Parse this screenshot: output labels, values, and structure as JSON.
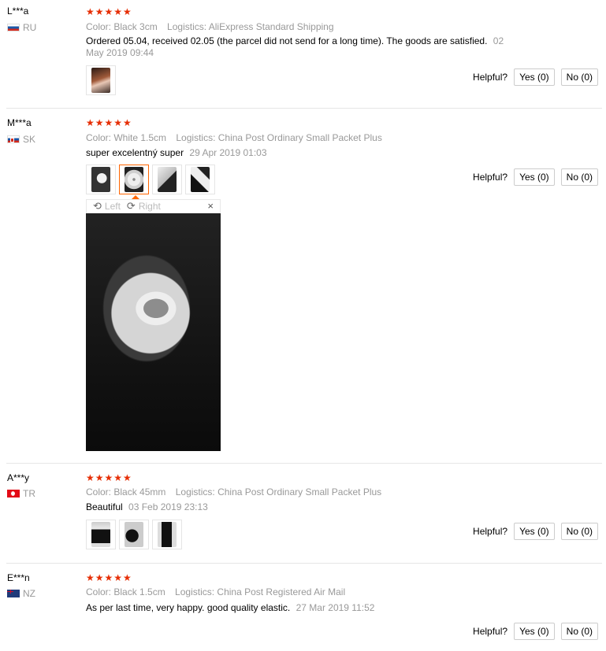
{
  "reviews": [
    {
      "user": "L***a",
      "country": "RU",
      "stars": "★★★★★",
      "color": "Color: Black 3cm",
      "logistics": "Logistics: AliExpress Standard Shipping",
      "text": "Ordered 05.04, received 02.05 (the parcel did not send for a long time). The goods are satisfied.",
      "date_part1": "02",
      "date_part2": "May 2019 09:44",
      "helpful": "Helpful?",
      "yes": "Yes (0)",
      "no": "No (0)"
    },
    {
      "user": "M***a",
      "country": "SK",
      "stars": "★★★★★",
      "color": "Color: White 1.5cm",
      "logistics": "Logistics: China Post Ordinary Small Packet Plus",
      "text": "super excelentný super",
      "date": "29 Apr 2019 01:03",
      "helpful": "Helpful?",
      "yes": "Yes (0)",
      "no": "No (0)",
      "viewer": {
        "left": "Left",
        "right": "Right",
        "close": "×"
      }
    },
    {
      "user": "A***y",
      "country": "TR",
      "stars": "★★★★★",
      "color": "Color: Black 45mm",
      "logistics": "Logistics: China Post Ordinary Small Packet Plus",
      "text": "Beautiful",
      "date": "03 Feb 2019 23:13",
      "helpful": "Helpful?",
      "yes": "Yes (0)",
      "no": "No (0)"
    },
    {
      "user": "E***n",
      "country": "NZ",
      "stars": "★★★★★",
      "color": "Color: Black 1.5cm",
      "logistics": "Logistics: China Post Registered Air Mail",
      "text": "As per last time, very happy. good quality elastic.",
      "date": "27 Mar 2019 11:52",
      "helpful": "Helpful?",
      "yes": "Yes (0)",
      "no": "No (0)"
    }
  ],
  "colors": {
    "star": "#e62e04",
    "meta": "#999999",
    "active_thumb": "#ff6600"
  },
  "icons": {
    "rotate_left": "rotate-left-icon",
    "rotate_right": "rotate-right-icon",
    "close": "close-icon"
  }
}
